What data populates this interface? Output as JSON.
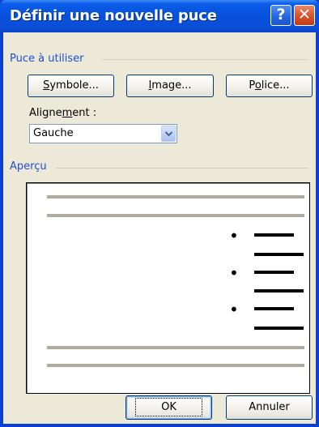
{
  "dialog": {
    "title": "Définir une nouvelle puce",
    "help_symbol": "?",
    "close_symbol": "✕"
  },
  "bullet_group": {
    "label": "Puce à utiliser",
    "symbol_button": {
      "mnemonic": "S",
      "rest": "ymbole..."
    },
    "image_button": {
      "mnemonic": "I",
      "rest": "mage..."
    },
    "font_button": {
      "before": "P",
      "mnemonic": "o",
      "rest": "lice..."
    }
  },
  "alignment": {
    "label_before": "Aligne",
    "label_mnemonic": "m",
    "label_after": "ent :",
    "selected": "Gauche"
  },
  "preview": {
    "label": "Aperçu",
    "bullet_char": "•",
    "bullet_count": 3
  },
  "footer": {
    "ok_label": "OK",
    "cancel_label": "Annuler"
  },
  "colors": {
    "titlebar": "#0751dc",
    "group_label": "#1f4fd2",
    "preview_gray_line": "#b0ab9f",
    "preview_text_line": "#000000"
  }
}
